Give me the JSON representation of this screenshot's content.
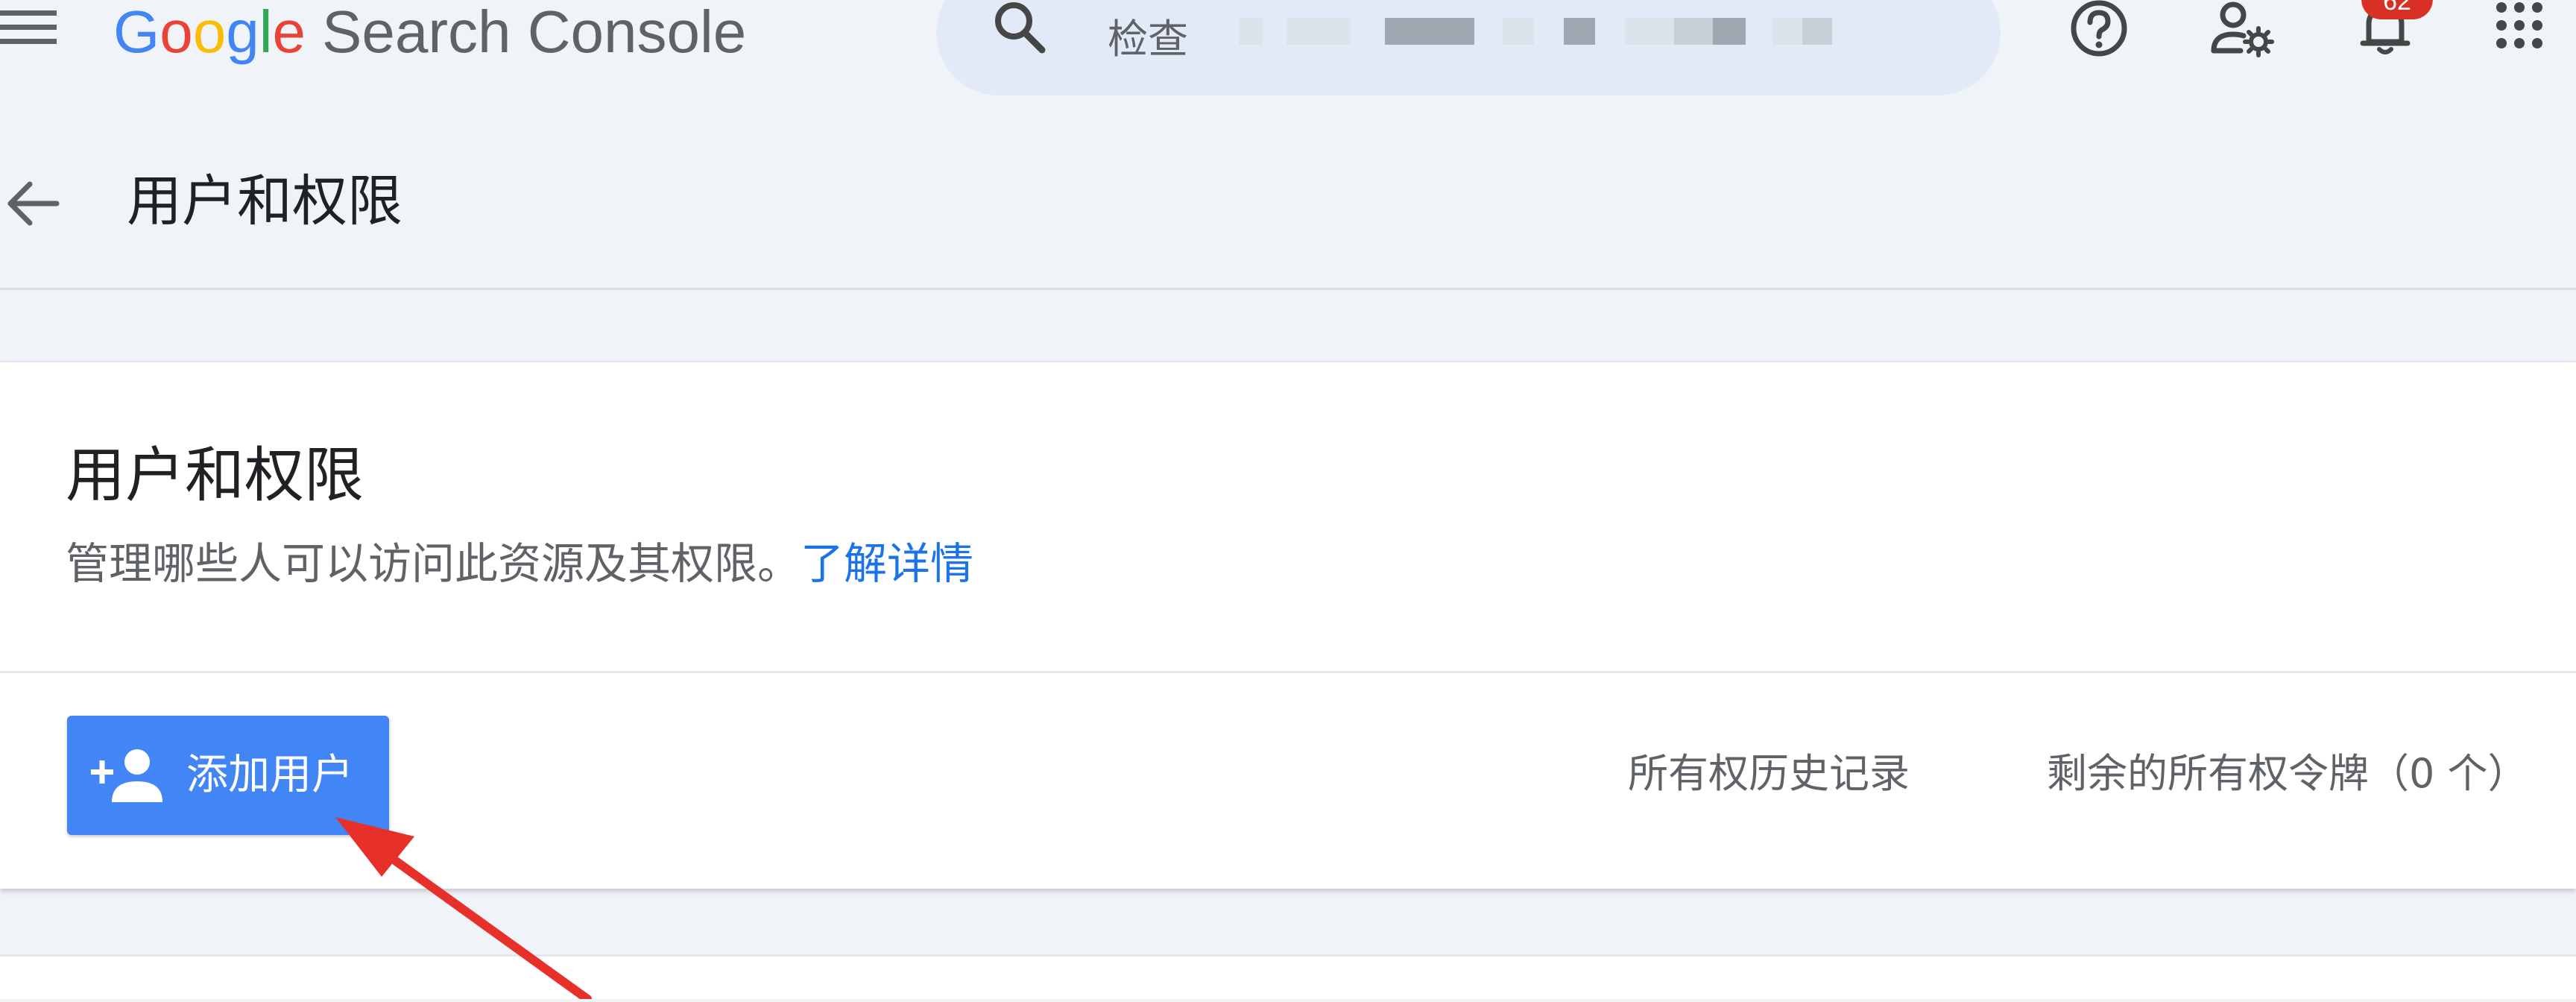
{
  "app": {
    "logo_text": "Google",
    "product_name": "Search Console"
  },
  "search": {
    "label": "检查"
  },
  "notifications": {
    "count": "62"
  },
  "icons": {
    "menu": "hamburger-menu-icon",
    "search": "search-icon",
    "help": "help-circle-icon",
    "user_settings": "user-settings-icon",
    "notifications": "bell-icon",
    "apps": "apps-grid-icon",
    "back": "arrow-back-icon",
    "add_user": "person-add-icon",
    "annotation": "red-arrow-annotation"
  },
  "page_header": {
    "title": "用户和权限"
  },
  "card": {
    "title": "用户和权限",
    "description": "管理哪些人可以访问此资源及其权限。",
    "learn_more": "了解详情"
  },
  "toolbar": {
    "add_user_label": "添加用户",
    "ownership_history_label": "所有权历史记录",
    "remaining_tokens_label": "剩余的所有权令牌（0 个）"
  },
  "colors": {
    "primary": "#4285f4",
    "link": "#1a73e8",
    "badge": "#d93025",
    "annotation": "#e8302a",
    "background": "#f0f4f9"
  }
}
